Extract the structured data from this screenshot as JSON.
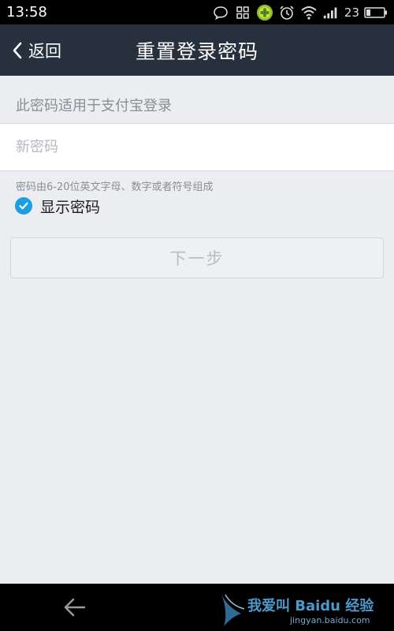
{
  "status_bar": {
    "time": "13:58",
    "battery_level": "23",
    "icons": [
      "chat-bubble-icon",
      "grid-icon",
      "plus-badge-icon",
      "alarm-icon",
      "wifi-icon",
      "signal-icon",
      "battery-icon"
    ]
  },
  "header": {
    "back_label": "返回",
    "title": "重置登录密码",
    "background": "#27303d"
  },
  "form": {
    "hint": "此密码适用于支付宝登录",
    "password_placeholder": "新密码",
    "password_value": "",
    "rule": "密码由6-20位英文字母、数字或者符号组成",
    "show_password_label": "显示密码",
    "show_password_checked": true,
    "next_button_label": "下一步",
    "accent": "#1a9fe0"
  },
  "watermark": {
    "text": "我爱叫 Baidu 经验",
    "url": "jingyan.baidu.com"
  }
}
